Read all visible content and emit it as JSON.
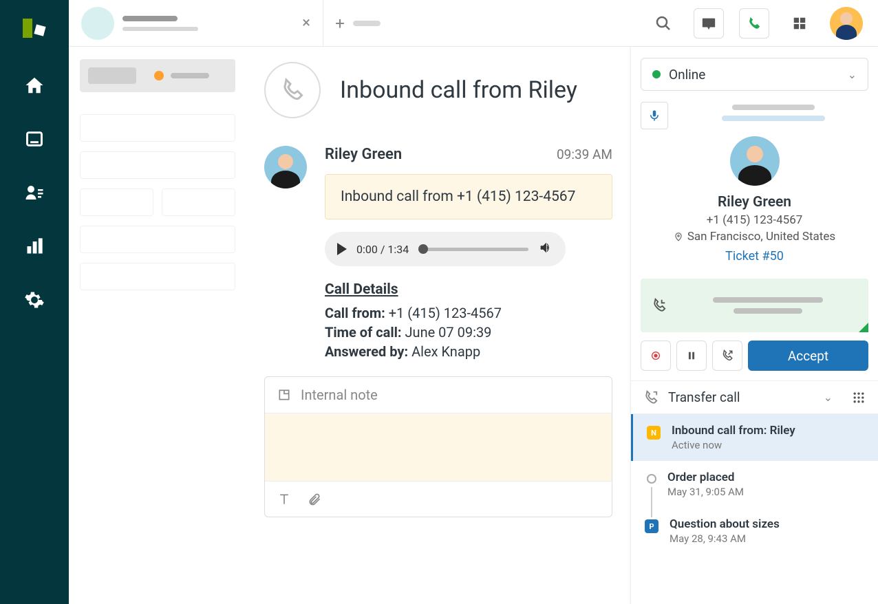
{
  "header": {
    "title": "Inbound call from Riley"
  },
  "thread": {
    "name": "Riley Green",
    "time": "09:39 AM",
    "message": "Inbound call from +1 (415) 123-4567",
    "audio_time": "0:00 / 1:34",
    "details_heading": "Call Details",
    "call_from_label": "Call from:",
    "call_from_value": " +1 (415) 123-4567",
    "time_label": "Time of call:",
    "time_value": " June 07 09:39",
    "answered_label": "Answered by:",
    "answered_value": " Alex Knapp"
  },
  "composer": {
    "label": "Internal note"
  },
  "callpanel": {
    "status": "Online",
    "caller_name": "Riley Green",
    "caller_phone": "+1 (415) 123-4567",
    "caller_location": "San Francisco, United States",
    "ticket_link": "Ticket #50",
    "accept_label": "Accept",
    "transfer_label": "Transfer call",
    "timeline": [
      {
        "title": "Inbound call from: Riley",
        "sub": "Active now"
      },
      {
        "title": "Order placed",
        "sub": "May 31, 9:05 AM"
      },
      {
        "title": "Question about sizes",
        "sub": "May 28, 9:43 AM"
      }
    ]
  }
}
